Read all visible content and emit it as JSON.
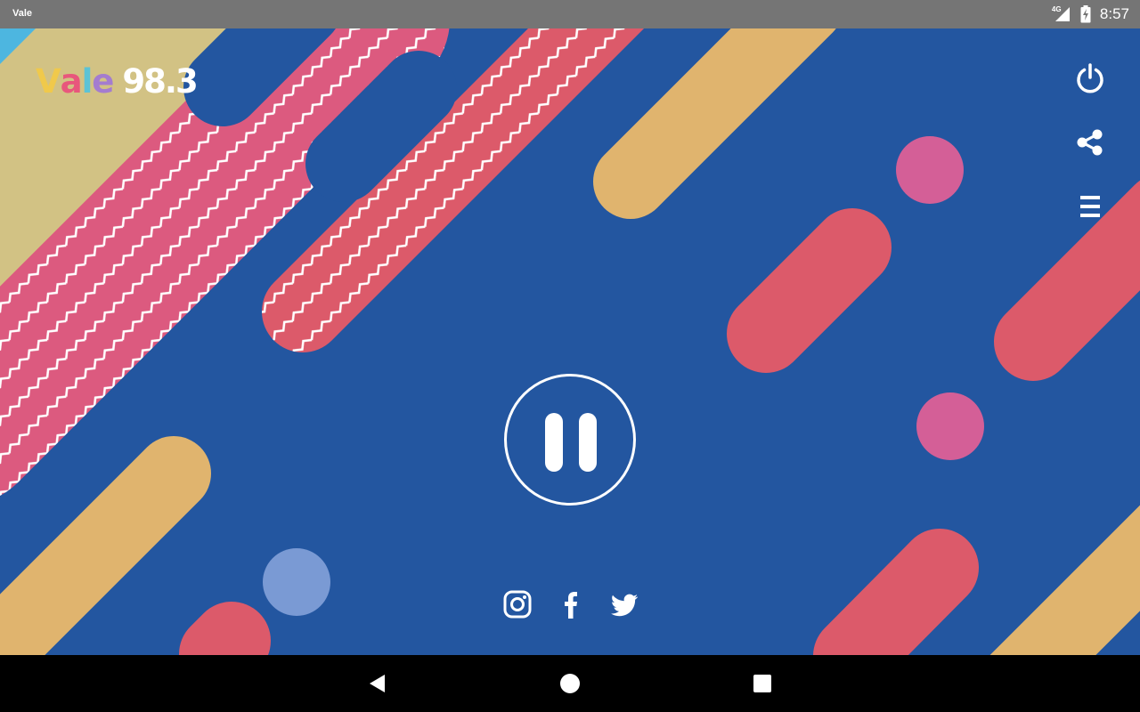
{
  "status_bar": {
    "app_name": "Vale",
    "network": "4G",
    "time": "8:57"
  },
  "logo": {
    "word_letters": [
      "V",
      "a",
      "l",
      "e"
    ],
    "letter_colors": [
      "#f0c94b",
      "#e8577c",
      "#5cc3d6",
      "#a47ccf"
    ],
    "frequency": "98.3"
  },
  "top_actions": {
    "icons": [
      "power-icon",
      "share-icon",
      "menu-icon"
    ]
  },
  "player": {
    "state": "playing",
    "control_icon": "pause-icon"
  },
  "social": {
    "icons": [
      "instagram-icon",
      "facebook-icon",
      "twitter-icon"
    ]
  },
  "nav_bar": {
    "icons": [
      "back-icon",
      "home-icon",
      "recents-icon"
    ]
  },
  "colors": {
    "background_blue": "#2356a0",
    "stripe_yellow": "#e0b46e",
    "stripe_red": "#dc5a6a",
    "dot_pink": "#d45f97",
    "dot_light_blue": "#7a9ad4",
    "corner_yellow": "#d2c284",
    "corner_cyan": "#4db6e0",
    "status_gray": "#757575",
    "nav_black": "#000000"
  }
}
